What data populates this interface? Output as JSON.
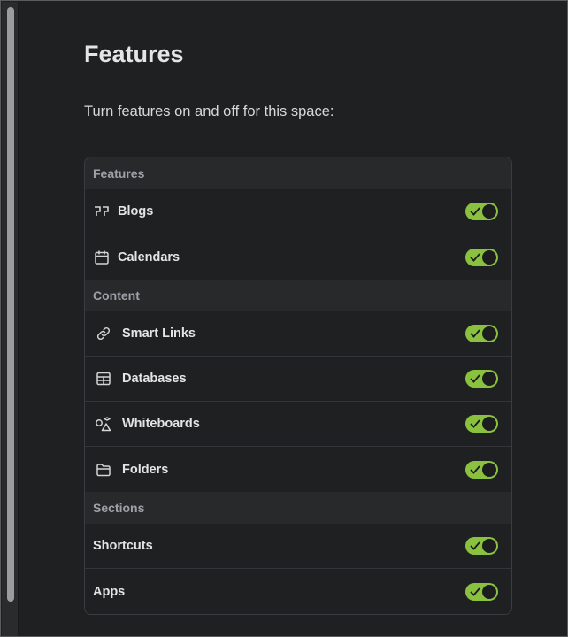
{
  "page": {
    "title": "Features",
    "subtitle": "Turn features on and off for this space:"
  },
  "colors": {
    "toggle_on": "#8ac13f",
    "background": "#1f2021"
  },
  "groups": [
    {
      "header": "Features",
      "items": [
        {
          "label": "Blogs",
          "icon": "quote-icon",
          "enabled": true
        },
        {
          "label": "Calendars",
          "icon": "calendar-icon",
          "enabled": true
        }
      ]
    },
    {
      "header": "Content",
      "items": [
        {
          "label": "Smart Links",
          "icon": "link-icon",
          "enabled": true
        },
        {
          "label": "Databases",
          "icon": "table-icon",
          "enabled": true
        },
        {
          "label": "Whiteboards",
          "icon": "shapes-icon",
          "enabled": true
        },
        {
          "label": "Folders",
          "icon": "folder-icon",
          "enabled": true
        }
      ]
    },
    {
      "header": "Sections",
      "items": [
        {
          "label": "Shortcuts",
          "enabled": true
        },
        {
          "label": "Apps",
          "enabled": true
        }
      ]
    }
  ]
}
